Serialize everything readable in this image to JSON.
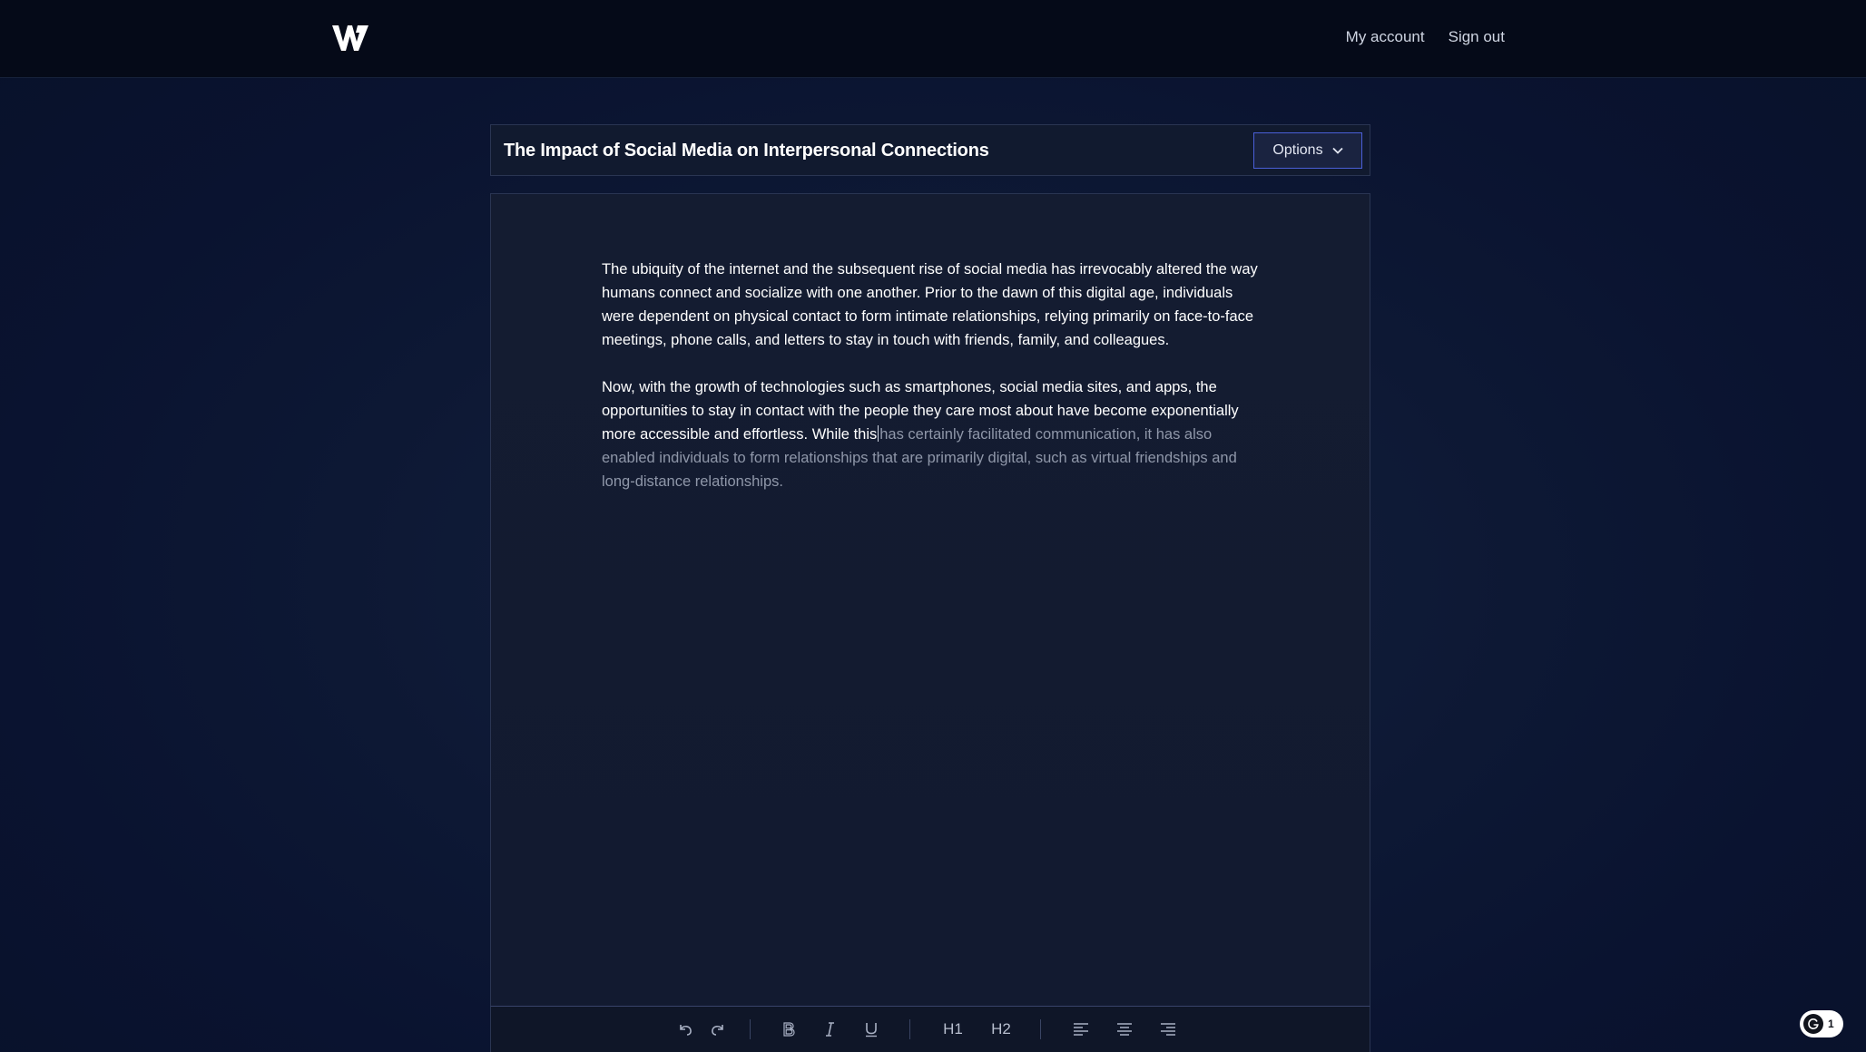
{
  "header": {
    "logo_icon": "w-logo-icon",
    "nav": {
      "my_account": "My account",
      "sign_out": "Sign out"
    }
  },
  "document": {
    "title": "The Impact of Social Media on Interpersonal Connections",
    "options_label": "Options",
    "paragraphs": [
      {
        "typed": "The ubiquity of the internet and the subsequent rise of social media has irrevocably altered the way humans connect and socialize with one another. Prior to the dawn of this digital age, individuals were dependent on physical contact to form intimate relationships, relying primarily on face-to-face meetings, phone calls, and letters to stay in touch with friends, family, and colleagues.",
        "suggested": ""
      },
      {
        "typed": "Now, with the growth of technologies such as smartphones, social media sites, and apps, the opportunities to stay in contact with the people they care most about have become exponentially more accessible and effortless. While this",
        "suggested": "has certainly facilitated communication, it has also enabled individuals to form relationships that are primarily digital, such as virtual friendships and long-distance relationships."
      }
    ]
  },
  "toolbar": {
    "icons": [
      "undo-icon",
      "redo-icon",
      "bold-icon",
      "italic-icon",
      "underline-icon",
      "align-left-icon",
      "align-center-icon",
      "align-right-icon"
    ],
    "h1_label": "H1",
    "h2_label": "H2"
  },
  "badge": {
    "icon": "grammar-assistant-icon",
    "count": "1"
  },
  "colors": {
    "background": "#0d1834",
    "topbar": "#050a18",
    "panel": "#141c31",
    "accent_border": "#4a5fd8",
    "suggested_text": "#8f97a9"
  }
}
